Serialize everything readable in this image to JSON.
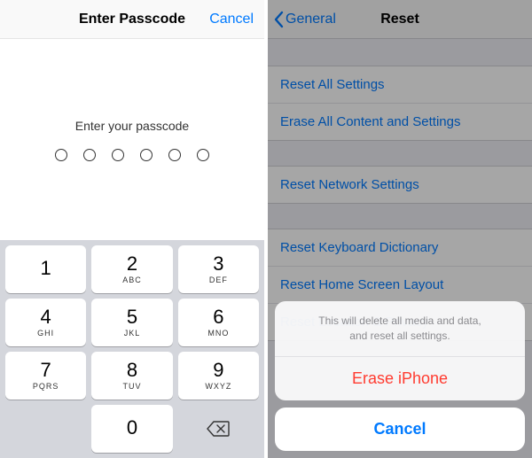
{
  "left": {
    "title": "Enter Passcode",
    "cancel": "Cancel",
    "prompt": "Enter your passcode",
    "dot_count": 6,
    "keys": {
      "k1": {
        "num": "1",
        "sub": ""
      },
      "k2": {
        "num": "2",
        "sub": "ABC"
      },
      "k3": {
        "num": "3",
        "sub": "DEF"
      },
      "k4": {
        "num": "4",
        "sub": "GHI"
      },
      "k5": {
        "num": "5",
        "sub": "JKL"
      },
      "k6": {
        "num": "6",
        "sub": "MNO"
      },
      "k7": {
        "num": "7",
        "sub": "PQRS"
      },
      "k8": {
        "num": "8",
        "sub": "TUV"
      },
      "k9": {
        "num": "9",
        "sub": "WXYZ"
      },
      "k0": {
        "num": "0",
        "sub": ""
      }
    }
  },
  "right": {
    "back_label": "General",
    "title": "Reset",
    "items": {
      "g1a": "Reset All Settings",
      "g1b": "Erase All Content and Settings",
      "g2a": "Reset Network Settings",
      "g3a": "Reset Keyboard Dictionary",
      "g3b": "Reset Home Screen Layout",
      "g3c": "Reset Location & Privacy"
    },
    "sheet": {
      "message_line1": "This will delete all media and data,",
      "message_line2": "and reset all settings.",
      "erase": "Erase iPhone",
      "cancel": "Cancel"
    }
  }
}
